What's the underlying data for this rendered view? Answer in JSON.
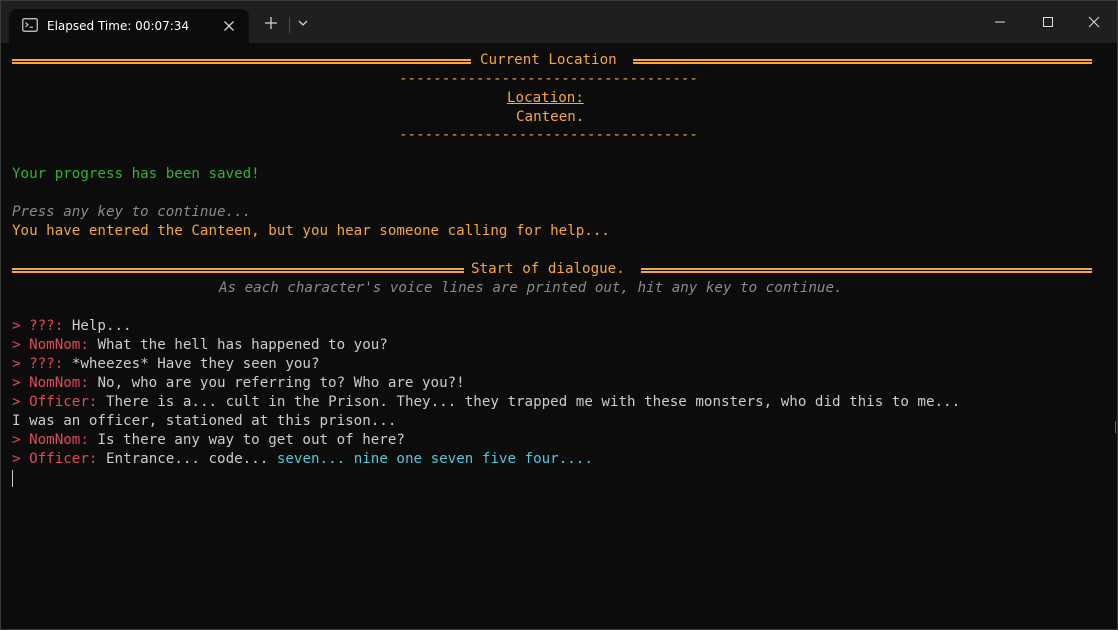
{
  "tab": {
    "title": "Elapsed Time: 00:07:34",
    "icon": "terminal-icon"
  },
  "colors": {
    "orange": "#f5a742",
    "green": "#2fb52f",
    "red": "#e04a55",
    "cyan": "#50c8d8",
    "grey": "#8a8a8a",
    "text": "#cccccc",
    "background": "#0c0c0c"
  },
  "terminal": {
    "location_header": "Current Location",
    "location_rule": "-----------------------------------",
    "location_label": "Location:",
    "location_value": "Canteen.",
    "saved_message": "Your progress has been saved!",
    "press_key": "Press any key to continue...",
    "entered_message": "You have entered the Canteen, but you hear someone calling for help...",
    "dialogue_header": "Start of dialogue.",
    "dialogue_hint": "As each character's voice lines are printed out, hit any key to continue.",
    "prompt": ">",
    "dialogue": [
      {
        "speaker": "???:",
        "text": "Help..."
      },
      {
        "speaker": "NomNom:",
        "text": "What the hell has happened to you?"
      },
      {
        "speaker": "???:",
        "text": "*wheezes* Have they seen you?"
      },
      {
        "speaker": "NomNom:",
        "text": "No, who are you referring to? Who are you?!"
      },
      {
        "speaker": "Officer:",
        "text": "There is a... cult in the Prison. They... they trapped me with these monsters, who did this to me..."
      },
      {
        "speaker": "",
        "text": "I was an officer, stationed at this prison..."
      },
      {
        "speaker": "NomNom:",
        "text": "Is there any way to get out of here?"
      },
      {
        "speaker": "Officer:",
        "text": "Entrance... code...",
        "highlight": "seven... nine one seven five four...."
      }
    ]
  }
}
